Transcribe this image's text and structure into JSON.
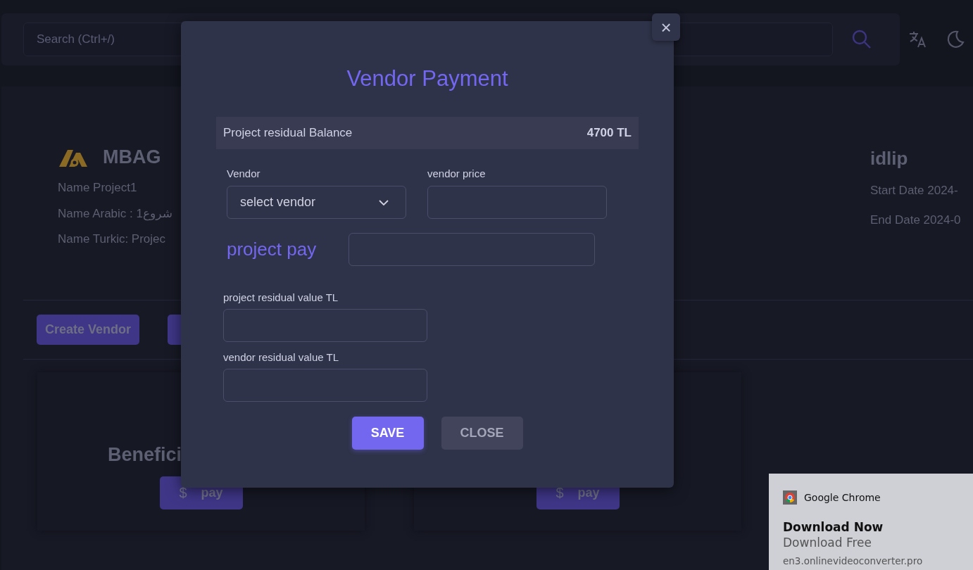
{
  "navbar": {
    "search": {
      "placeholder": "Search (Ctrl+/)"
    }
  },
  "project": {
    "logo_text": "MBAG",
    "details": [
      "Name Project1",
      "Name Arabic : شروع1",
      "Name Turkic: Projec"
    ],
    "location": "idlip",
    "dates": [
      "Start Date 2024-",
      "End Date 2024-0"
    ]
  },
  "actions": [
    {
      "label": "Create Vendor"
    }
  ],
  "cards": [
    {
      "title": "Benefici",
      "button": {
        "icon": "$",
        "label": "pay"
      }
    },
    {
      "button": {
        "icon": "$",
        "label": "pay"
      }
    }
  ],
  "dialog": {
    "close_symbol": "×",
    "title": "Vendor Payment",
    "balance": {
      "label": "Project residual Balance",
      "value": "4700 TL"
    },
    "vendor": {
      "label": "Vendor",
      "value": "select vendor"
    },
    "vendor_price": {
      "label": "vendor price"
    },
    "project_pay": {
      "label": "project pay"
    },
    "project_residual": {
      "label": "project residual value TL"
    },
    "vendor_residual": {
      "label": "vendor residual value TL"
    },
    "buttons": [
      {
        "label": "SAVE",
        "kind": "primary"
      },
      {
        "label": "CLOSE",
        "kind": "secondary"
      }
    ]
  },
  "notification": {
    "app": "Google Chrome",
    "title": "Download Now",
    "body": "Download Free",
    "source": "en3.onlinevideoconverter.pro"
  }
}
